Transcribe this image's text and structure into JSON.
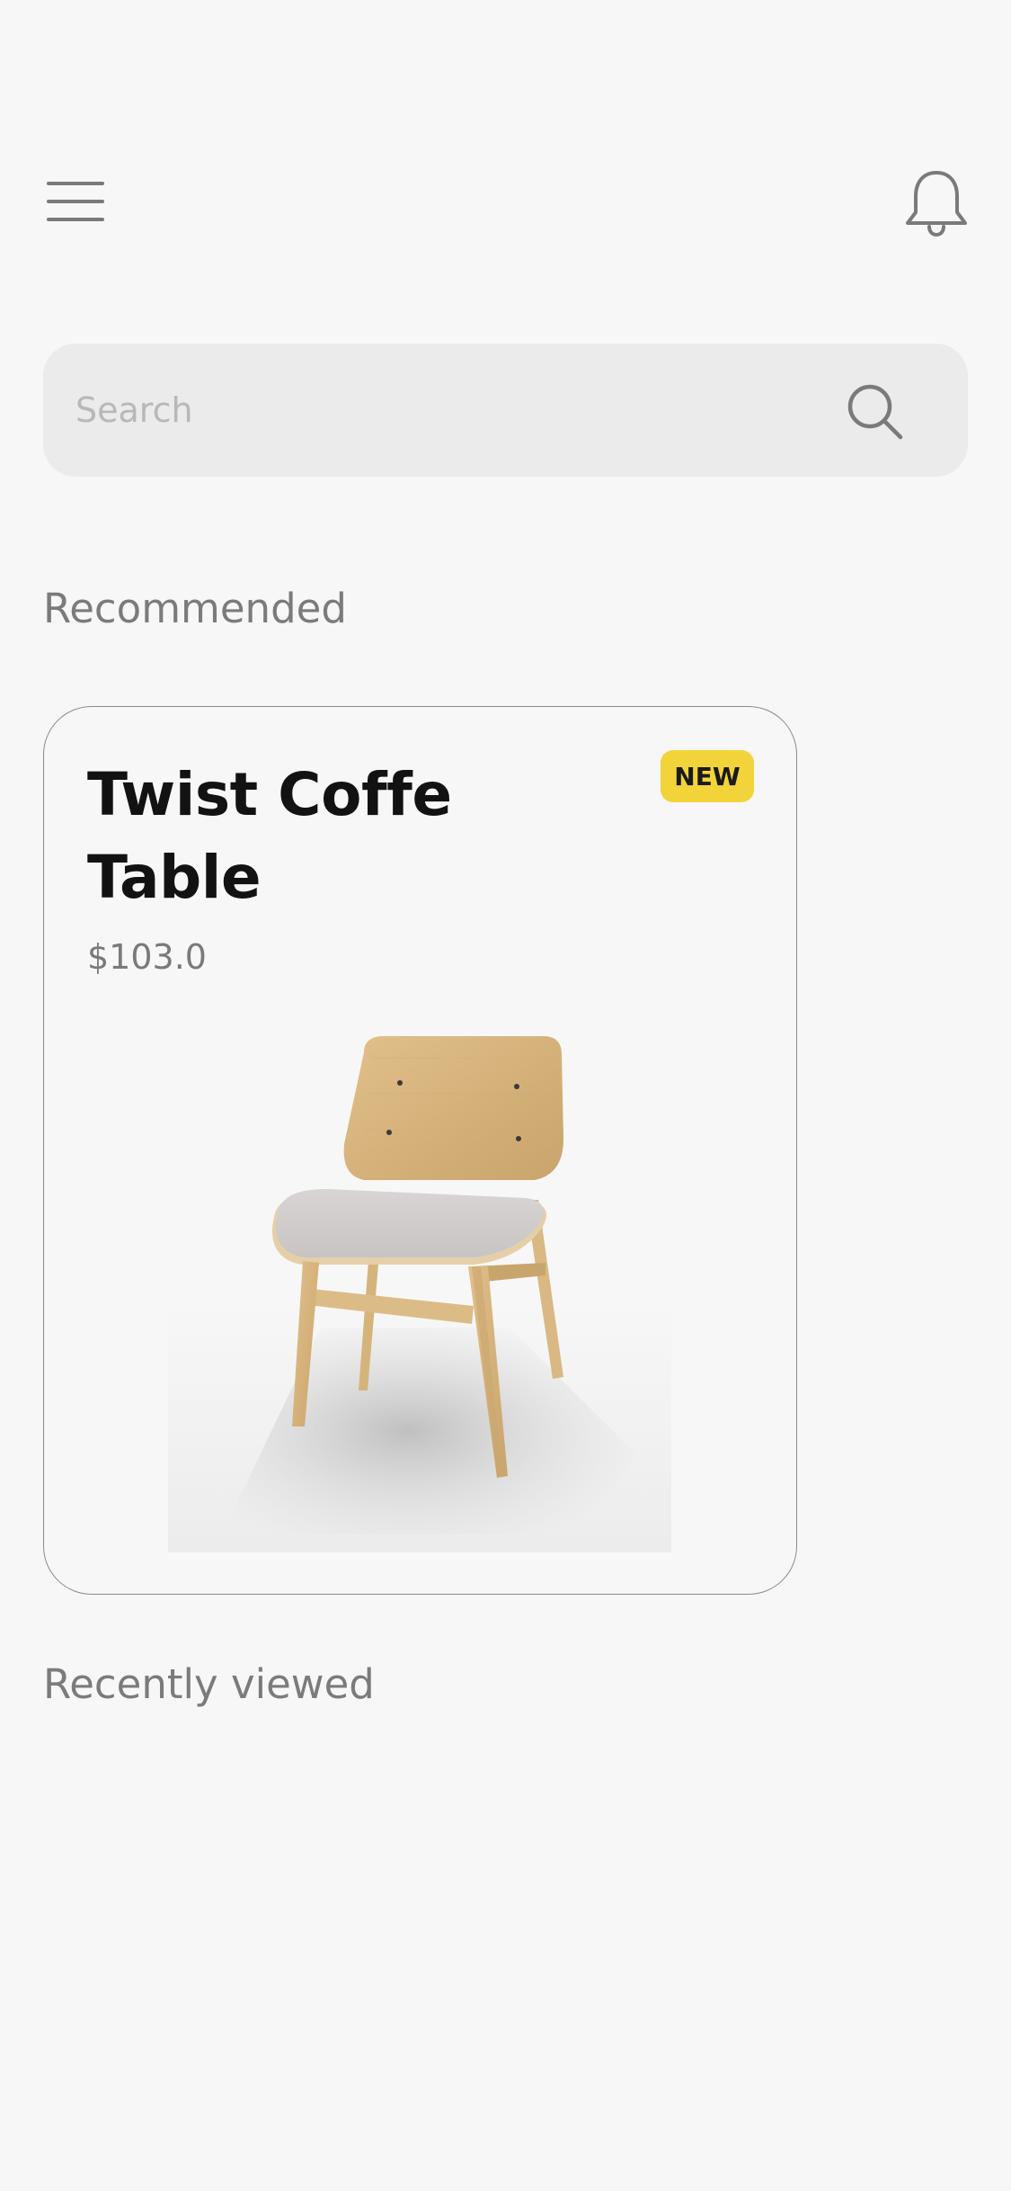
{
  "header": {
    "menu_icon": "hamburger-menu-icon",
    "notification_icon": "bell-icon"
  },
  "search": {
    "placeholder": "Search",
    "value": "",
    "icon": "search-icon"
  },
  "sections": {
    "recommended": "Recommended",
    "recently_viewed": "Recently viewed"
  },
  "products": [
    {
      "name": "Twist Coffe Table",
      "price": "$103.0",
      "badge": "NEW",
      "image": "wooden-chair-image"
    }
  ],
  "colors": {
    "background": "#f7f7f7",
    "search_bg": "#ebebeb",
    "badge": "#f2d43a",
    "icon": "#7a7a7a",
    "title": "#121212",
    "muted_text": "#7b7b7b"
  }
}
